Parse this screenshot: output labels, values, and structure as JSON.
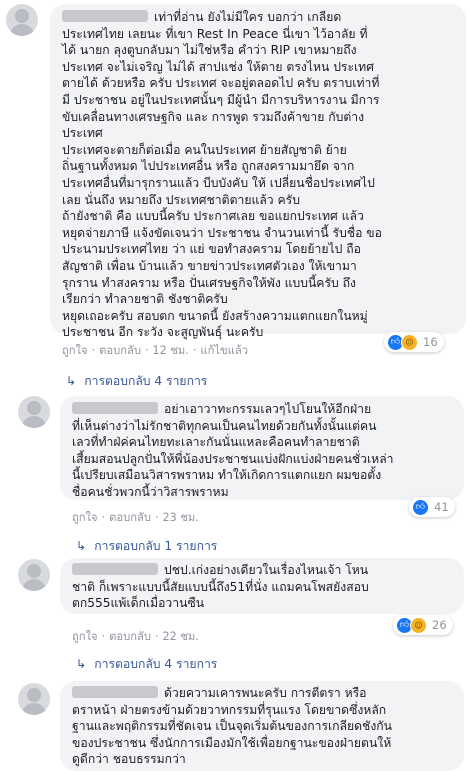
{
  "comments": [
    {
      "text": "เท่าที่อ่าน ยังไม่มีใคร บอกว่า เกลียด\nประเทศไทย เลยนะ ที่เขา Rest In Peace นี่เขา ไว้อาลัย ที่\nได้ นายก ลุงตูบกลับมา ไม่ใช่หรือ คำว่า RIP เขาหมายถึง\nประเทศ จะไม่เจริญ ไม่ได้ สาปแช่ง ให้ตาย ตรงไหน ประเทศ\nตายได้ ด้วยหรือ ครับ ประเทศ จะอยู่ตลอดไป ครับ ตราบเท่าที่\nมี ประชาชน อยู่ในประเทศนั้นๆ มีผู้นำ มีการบริหารงาน มีการ\nขับเคลื่อนทางเศรษฐกิจ และ การพูด รวมถึงค้าขาย กับต่าง\nประเทศ\nประเทศจะตายก็ต่อเมื่อ คนในประเทศ ย้ายสัญชาติ ย้าย\nถิ่นฐานทั้งหมด ไปประเทศอื่น หรือ ถูกสงครามมายึด จาก\nประเทศอื่นที่มารุกรานแล้ว บีบบังคับ ให้ เปลี่ยนชื่อประเทศไป\nเลย นั่นถึง หมายถึง ประเทศชาติตายแล้ว ครับ\nถ้ายังชาติ คือ แบบนี้ครับ ประกาศเลย ขอแยกประเทศ แล้ว\nหยุดจ่ายภาษี แจ้งขัดเจนว่า ประชาชน จำนวนเท่านี้ รับชื่อ ขอ\nประนามประเทศไทย ว่า แย่ ขอทำสงคราม โดยย้ายไป ถือ\nสัญชาติ เพื่อน บ้านแล้ว ขายข่าวประเทศตัวเอง ให้เขามา\nรุกราน ทำสงคราม หรือ ปั่นเศรษฐกิจให้พัง แบบนี้ครับ ถึง\nเรียกว่า ทำลายชาติ ชังชาติครับ\nหยุดเถอะครับ สอบตก ขนาดนี้ ยังสร้างความแตกแยกในหมู่\nประชาชน อีก ระวัง จะสูญพันธุ์ นะครับ",
      "actions": {
        "like": "ถูกใจ",
        "reply": "ตอบกลับ",
        "time": "12 ชม.",
        "edited": "แก้ไขแล้ว"
      },
      "reaction_icons": [
        "like-icon",
        "sad-icon"
      ],
      "reaction_count": "16",
      "replies": "การตอบกลับ 4 รายการ"
    },
    {
      "text": "อย่าเอาวาทะกรรมเลวๆไปโยนให้อีกฝ่าย\nที่เห็นต่างว่าไม่รักชาติทุกคนเป็นคนไทยด้วยกันทั้งนั้นแต่คน\nเลวที่ทำฝ่ค่คนไทยทะเลาะกันนั่นแหละคือคนทำลายชาติ\nเสี้ยมสอนปลูกปั่นให้พี่น้องประชาชนแบ่งฝักแบ่งฝ่ายคนชั่วเหล่า\nนี้เปรียบเสมือนวิสารพราหม ทำให้เกิดการแตกแยก ผมขอตั้ง\nชื่อคนชั่วพวกนี้ว่าวิสารพราหม",
      "actions": {
        "like": "ถูกใจ",
        "reply": "ตอบกลับ",
        "time": "23 ชม."
      },
      "reaction_icons": [
        "like-icon"
      ],
      "reaction_count": "41",
      "replies": "การตอบกลับ 1 รายการ"
    },
    {
      "text": "ปชป.เก่งอย่างเดียวในเรื่องไหนเจ้า โหน\nชาติ ก็เพราะแบบนี้สัยแบบนี้ถึง51ที่นั่ง แถมคนโพสยังสอบ\nตก555แพ้เด็กเมื่อวานซืน",
      "actions": {
        "like": "ถูกใจ",
        "reply": "ตอบกลับ",
        "time": "22 ชม."
      },
      "reaction_icons": [
        "like-icon",
        "haha-icon"
      ],
      "reaction_count": "26",
      "replies": "การตอบกลับ 4 รายการ"
    },
    {
      "text": "ด้วยความเคารพนะครับ การตีตรา หรือ\nตราหน้า ฝ่ายตรงข้ามด้วยวาทกรรมที่รุนแรง โดยขาดซึ่งหลัก\nฐานและพฤติกรรมที่ชัดเจน เป็นจุดเริ่มต้นของการเกลียดชังกัน\nของประชาชน ซึ่งนักการเมืองมักใช้เพื่อยกฐานะของฝ่ายตนให้\nดูดีกว่า ชอบธรรมกว่า"
    }
  ]
}
